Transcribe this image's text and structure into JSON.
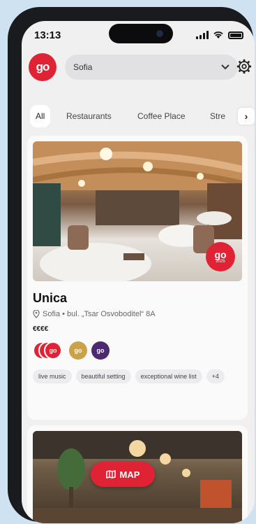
{
  "status_bar": {
    "time": "13:13"
  },
  "header": {
    "logo_text": "go",
    "city_select": {
      "value": "Sofia"
    }
  },
  "filters": {
    "items": [
      "All",
      "Restaurants",
      "Coffee Place",
      "Stre"
    ],
    "active_index": 0
  },
  "listing": {
    "name": "Unica",
    "address": "Sofia • bul. „Tsar Osvoboditel“ 8A",
    "price_level": "€€€€",
    "photo_badge": {
      "line1": "go",
      "line2": "2025"
    },
    "award_badges": [
      "go",
      "go",
      "go"
    ],
    "tags": [
      "live music",
      "beautiful setting",
      "exceptional wine list"
    ],
    "more_tags": "+4"
  },
  "map_button": {
    "label": "MAP"
  },
  "colors": {
    "brand_red": "#e02334",
    "screen_bg": "#f0f0f1",
    "card_bg": "#fafafa",
    "gold_badge": "#c9a24a",
    "purple_badge": "#4b2a6d"
  }
}
